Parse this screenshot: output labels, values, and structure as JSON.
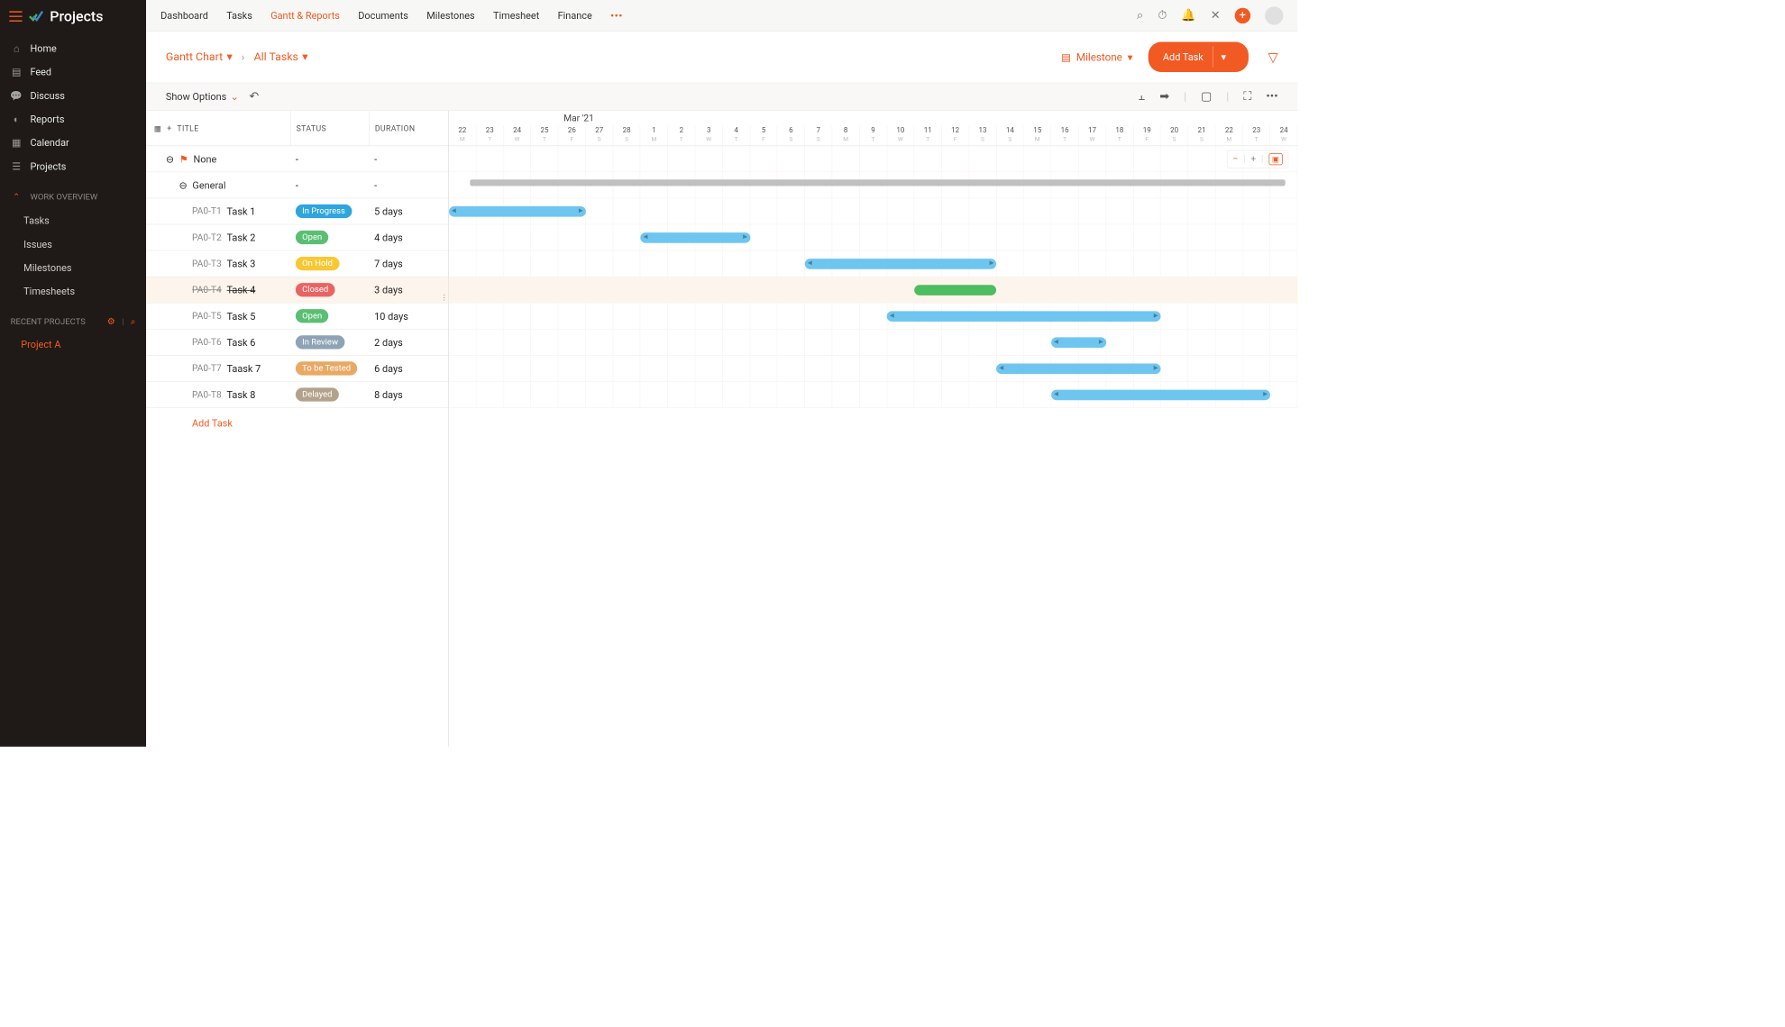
{
  "app": {
    "title": "Projects"
  },
  "sidebar": {
    "items": [
      {
        "label": "Home"
      },
      {
        "label": "Feed"
      },
      {
        "label": "Discuss"
      },
      {
        "label": "Reports"
      },
      {
        "label": "Calendar"
      },
      {
        "label": "Projects"
      }
    ],
    "section_label": "WORK OVERVIEW",
    "sub_items": [
      {
        "label": "Tasks"
      },
      {
        "label": "Issues"
      },
      {
        "label": "Milestones"
      },
      {
        "label": "Timesheets"
      }
    ],
    "recent_label": "RECENT PROJECTS",
    "recent_projects": [
      {
        "label": "Project A"
      }
    ]
  },
  "topnav": {
    "tabs": [
      "Dashboard",
      "Tasks",
      "Gantt & Reports",
      "Documents",
      "Milestones",
      "Timesheet",
      "Finance"
    ],
    "active_index": 2
  },
  "subnav": {
    "dropdown1": "Gantt Chart",
    "dropdown2": "All Tasks",
    "milestone_label": "Milestone",
    "add_task_label": "Add Task"
  },
  "options_bar": {
    "show_options_label": "Show Options"
  },
  "grid": {
    "col_title": "TITLE",
    "col_status": "STATUS",
    "col_duration": "DURATION",
    "group_label": "None",
    "subgroup_label": "General",
    "tasks": [
      {
        "id": "PA0-T1",
        "name": "Task 1",
        "status": "In Progress",
        "status_color": "#2ea5de",
        "duration": "5 days"
      },
      {
        "id": "PA0-T2",
        "name": "Task 2",
        "status": "Open",
        "status_color": "#5bbf73",
        "duration": "4 days"
      },
      {
        "id": "PA0-T3",
        "name": "Task 3",
        "status": "On Hold",
        "status_color": "#f7c834",
        "duration": "7 days"
      },
      {
        "id": "PA0-T4",
        "name": "Task 4",
        "status": "Closed",
        "status_color": "#e96364",
        "duration": "3 days",
        "strike": true
      },
      {
        "id": "PA0-T5",
        "name": "Task 5",
        "status": "Open",
        "status_color": "#5bbf73",
        "duration": "10 days"
      },
      {
        "id": "PA0-T6",
        "name": "Task 6",
        "status": "In Review",
        "status_color": "#8ea3b5",
        "duration": "2 days"
      },
      {
        "id": "PA0-T7",
        "name": "Taask 7",
        "status": "To be Tested",
        "status_color": "#e9a965",
        "duration": "6 days"
      },
      {
        "id": "PA0-T8",
        "name": "Task 8",
        "status": "Delayed",
        "status_color": "#b3a28b",
        "duration": "8 days"
      }
    ],
    "add_task_link": "Add Task",
    "dash": "-"
  },
  "gantt": {
    "month_label": "Mar '21",
    "days": [
      22,
      23,
      24,
      25,
      26,
      27,
      28,
      1,
      2,
      3,
      4,
      5,
      6,
      7,
      8,
      9,
      10,
      11,
      12,
      13,
      14,
      15,
      16,
      17,
      18,
      19,
      20,
      21,
      22,
      23,
      24
    ],
    "dows": [
      "M",
      "T",
      "W",
      "T",
      "F",
      "S",
      "S",
      "M",
      "T",
      "W",
      "T",
      "F",
      "S",
      "S",
      "M",
      "T",
      "W",
      "T",
      "F",
      "S",
      "S",
      "M",
      "T",
      "W",
      "T",
      "F",
      "S",
      "S",
      "M",
      "T",
      "W"
    ]
  },
  "chart_data": {
    "type": "gantt",
    "month": "Mar '21",
    "date_range": {
      "start": "2021-02-22",
      "end": "2021-03-24"
    },
    "groups": [
      {
        "name": "None",
        "children": [
          {
            "name": "General",
            "start": "2021-02-22",
            "end": "2021-03-24",
            "type": "summary",
            "children": [
              {
                "id": "PA0-T1",
                "name": "Task 1",
                "status": "In Progress",
                "start": "2021-02-22",
                "end": "2021-02-26",
                "duration_days": 5,
                "color": "#6ec6f0"
              },
              {
                "id": "PA0-T2",
                "name": "Task 2",
                "status": "Open",
                "start": "2021-03-01",
                "end": "2021-03-04",
                "duration_days": 4,
                "color": "#6ec6f0"
              },
              {
                "id": "PA0-T3",
                "name": "Task 3",
                "status": "On Hold",
                "start": "2021-03-07",
                "end": "2021-03-13",
                "duration_days": 7,
                "color": "#6ec6f0"
              },
              {
                "id": "PA0-T4",
                "name": "Task 4",
                "status": "Closed",
                "start": "2021-03-11",
                "end": "2021-03-13",
                "duration_days": 3,
                "color": "#4dbd5f"
              },
              {
                "id": "PA0-T5",
                "name": "Task 5",
                "status": "Open",
                "start": "2021-03-10",
                "end": "2021-03-19",
                "duration_days": 10,
                "color": "#6ec6f0"
              },
              {
                "id": "PA0-T6",
                "name": "Task 6",
                "status": "In Review",
                "start": "2021-03-16",
                "end": "2021-03-17",
                "duration_days": 2,
                "color": "#6ec6f0"
              },
              {
                "id": "PA0-T7",
                "name": "Taask 7",
                "status": "To be Tested",
                "start": "2021-03-14",
                "end": "2021-03-19",
                "duration_days": 6,
                "color": "#6ec6f0"
              },
              {
                "id": "PA0-T8",
                "name": "Task 8",
                "status": "Delayed",
                "start": "2021-03-16",
                "end": "2021-03-23",
                "duration_days": 8,
                "color": "#6ec6f0"
              }
            ]
          }
        ]
      }
    ]
  }
}
